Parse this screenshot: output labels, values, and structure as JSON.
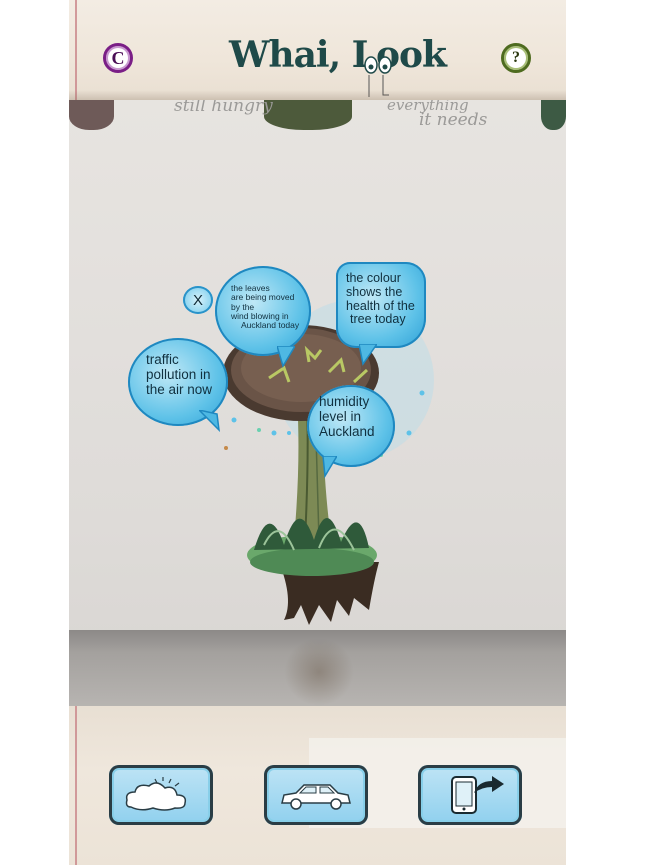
{
  "app": {
    "title": "Whai, Look",
    "header_buttons": {
      "copyright_symbol": "C",
      "help_symbol": "?"
    }
  },
  "camera_view": {
    "wall_texts": [
      "still hungry",
      "everything",
      "it needs"
    ],
    "close_label": "X",
    "bubbles": [
      {
        "id": "wind",
        "lines": [
          "the leaves",
          "are being moved",
          "by the",
          "wind blowing in",
          "Auckland today"
        ]
      },
      {
        "id": "health",
        "lines": [
          "the colour",
          "shows the",
          "health of the",
          "tree today"
        ]
      },
      {
        "id": "pollution",
        "lines": [
          "traffic",
          "pollution in",
          "the air now"
        ]
      },
      {
        "id": "humidity",
        "lines": [
          "humidity",
          "level in",
          "Auckland"
        ]
      }
    ]
  },
  "toolbar": {
    "buttons": [
      {
        "name": "weather",
        "icon": "cloud-icon"
      },
      {
        "name": "traffic",
        "icon": "car-icon"
      },
      {
        "name": "share",
        "icon": "tablet-share-icon"
      }
    ]
  },
  "colors": {
    "title": "#1f4a49",
    "bubble": "#5ec2e8",
    "bubble_border": "#1f88c0",
    "copyright_ring": "#7a1e86",
    "help_ring": "#4e6b1f",
    "tree_canopy": "#5e4a3e"
  }
}
